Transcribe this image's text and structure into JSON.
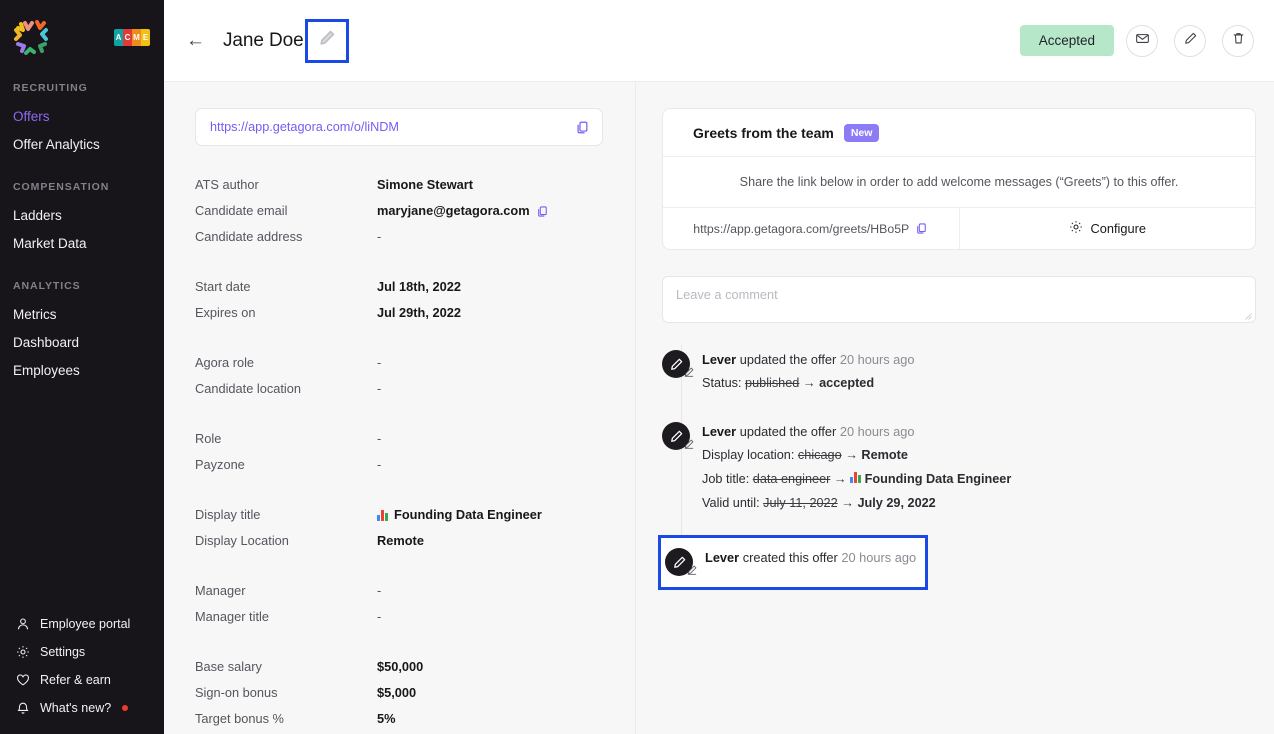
{
  "sidebar": {
    "logo_name": "agora-logo",
    "org_badge": {
      "name": "acme-logo",
      "letters": [
        "A",
        "C",
        "M",
        "E"
      ],
      "colors": [
        "#0fa3a3",
        "#e23a36",
        "#ef8a1f",
        "#f2c014"
      ]
    },
    "sections": [
      {
        "title": "RECRUITING",
        "items": [
          {
            "label": "Offers",
            "active": true
          },
          {
            "label": "Offer Analytics",
            "active": false
          }
        ]
      },
      {
        "title": "COMPENSATION",
        "items": [
          {
            "label": "Ladders",
            "active": false
          },
          {
            "label": "Market Data",
            "active": false
          }
        ]
      },
      {
        "title": "ANALYTICS",
        "items": [
          {
            "label": "Metrics",
            "active": false
          },
          {
            "label": "Dashboard",
            "active": false
          },
          {
            "label": "Employees",
            "active": false
          }
        ]
      }
    ],
    "bottom_items": [
      {
        "label": "Employee portal",
        "icon": "person-icon"
      },
      {
        "label": "Settings",
        "icon": "gear-icon"
      },
      {
        "label": "Refer & earn",
        "icon": "heart-icon"
      },
      {
        "label": "What's new?",
        "icon": "bell-icon",
        "has_dot": true
      }
    ],
    "active_color": "#8b6cf0",
    "background": "#17141a"
  },
  "topbar": {
    "back_label": "←",
    "title": "Jane Doe",
    "edit_title_icon": "pencil-icon",
    "status_label": "Accepted",
    "status_color": "#b6e7c9",
    "actions": [
      {
        "name": "email-button",
        "icon": "envelope-icon"
      },
      {
        "name": "edit-button",
        "icon": "pencil-icon"
      },
      {
        "name": "delete-button",
        "icon": "trash-icon"
      }
    ]
  },
  "offer": {
    "share_url": "https://app.getagora.com/o/liNDM",
    "copy_icon": "copy-icon",
    "fields_group1": [
      {
        "label": "ATS author",
        "value": "Simone Stewart",
        "dash": false,
        "copy": false
      },
      {
        "label": "Candidate email",
        "value": "maryjane@getagora.com",
        "dash": false,
        "copy": true
      },
      {
        "label": "Candidate address",
        "value": "-",
        "dash": true,
        "copy": false
      }
    ],
    "fields_group2": [
      {
        "label": "Start date",
        "value": "Jul 18th, 2022",
        "dash": false
      },
      {
        "label": "Expires on",
        "value": "Jul 29th, 2022",
        "dash": false
      }
    ],
    "fields_group3": [
      {
        "label": "Agora role",
        "value": "-",
        "dash": true
      },
      {
        "label": "Candidate location",
        "value": "-",
        "dash": true
      }
    ],
    "fields_group4": [
      {
        "label": "Role",
        "value": "-",
        "dash": true
      },
      {
        "label": "Payzone",
        "value": "-",
        "dash": true
      }
    ],
    "fields_group5": [
      {
        "label": "Display title",
        "value": "Founding Data Engineer",
        "dash": false,
        "emoji": "bar-chart-emoji"
      },
      {
        "label": "Display Location",
        "value": "Remote",
        "dash": false
      }
    ],
    "fields_group6": [
      {
        "label": "Manager",
        "value": "-",
        "dash": true
      },
      {
        "label": "Manager title",
        "value": "-",
        "dash": true
      }
    ],
    "fields_group7": [
      {
        "label": "Base salary",
        "value": "$50,000",
        "dash": false
      },
      {
        "label": "Sign-on bonus",
        "value": "$5,000",
        "dash": false
      },
      {
        "label": "Target bonus %",
        "value": "5%",
        "dash": false
      }
    ]
  },
  "greets_card": {
    "title": "Greets from the team",
    "badge": "New",
    "badge_color": "#8b7cf6",
    "description": "Share the link below in order to add welcome messages (“Greets”) to this offer.",
    "link": "https://app.getagora.com/greets/HBo5P",
    "configure_label": "Configure",
    "configure_icon": "gear-icon"
  },
  "comment": {
    "placeholder": "Leave a comment",
    "value": ""
  },
  "activity": [
    {
      "actor": "Lever",
      "action": "updated the offer",
      "time": "20 hours ago",
      "avatar_icon": "pencil-avatar-icon",
      "highlighted": false,
      "changes": [
        {
          "label": "Status:",
          "old": "published",
          "new": "accepted",
          "emoji": null
        }
      ]
    },
    {
      "actor": "Lever",
      "action": "updated the offer",
      "time": "20 hours ago",
      "avatar_icon": "pencil-avatar-icon",
      "highlighted": false,
      "changes": [
        {
          "label": "Display location:",
          "old": "chicago",
          "new": "Remote",
          "emoji": null
        },
        {
          "label": "Job title:",
          "old": "data engineer",
          "new": "Founding Data Engineer",
          "emoji": "bar-chart-emoji"
        },
        {
          "label": "Valid until:",
          "old": "July 11, 2022",
          "new": "July 29, 2022",
          "emoji": null
        }
      ]
    },
    {
      "actor": "Lever",
      "action": "created this offer",
      "time": "20 hours ago",
      "avatar_icon": "pencil-avatar-icon",
      "highlighted": true,
      "changes": []
    }
  ],
  "highlight_color": "#1b49e8"
}
